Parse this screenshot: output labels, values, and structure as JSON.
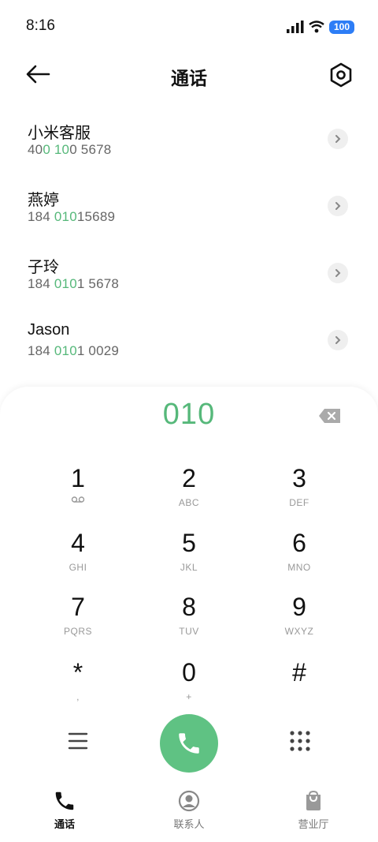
{
  "status_bar": {
    "time": "8:16",
    "battery": "100"
  },
  "header": {
    "title": "通话"
  },
  "contacts": [
    {
      "name": "小米客服",
      "number_parts": [
        "40",
        "0",
        " ",
        "10",
        "0 5678"
      ]
    },
    {
      "name": "燕婷",
      "number_parts": [
        "184 ",
        "010",
        "15689"
      ]
    },
    {
      "name": "子玲",
      "number_parts": [
        "184 ",
        "010",
        "1 5678"
      ]
    },
    {
      "name": "Jason",
      "number_parts": [
        "184 ",
        "010",
        "1 0029"
      ]
    }
  ],
  "dialer": {
    "dialed_number": "010",
    "keys": [
      {
        "digit": "1",
        "letters": ""
      },
      {
        "digit": "2",
        "letters": "ABC"
      },
      {
        "digit": "3",
        "letters": "DEF"
      },
      {
        "digit": "4",
        "letters": "GHI"
      },
      {
        "digit": "5",
        "letters": "JKL"
      },
      {
        "digit": "6",
        "letters": "MNO"
      },
      {
        "digit": "7",
        "letters": "PQRS"
      },
      {
        "digit": "8",
        "letters": "TUV"
      },
      {
        "digit": "9",
        "letters": "WXYZ"
      },
      {
        "digit": "*",
        "letters": ","
      },
      {
        "digit": "0",
        "letters": "+"
      },
      {
        "digit": "#",
        "letters": ""
      }
    ]
  },
  "tabs": [
    {
      "label": "通话",
      "icon": "phone-icon",
      "active": true
    },
    {
      "label": "联系人",
      "icon": "contact-icon",
      "active": false
    },
    {
      "label": "营业厅",
      "icon": "shop-bag-icon",
      "active": false
    }
  ],
  "colors": {
    "accent": "#56b87a",
    "call_button": "#5fc283"
  }
}
